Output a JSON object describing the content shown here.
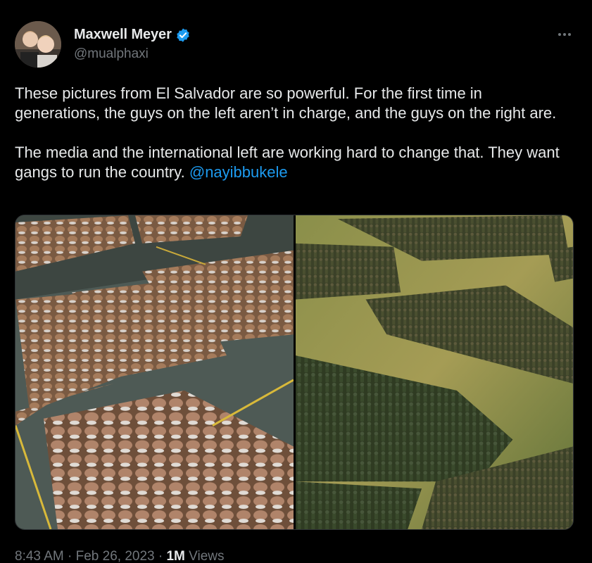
{
  "author": {
    "display_name": "Maxwell Meyer",
    "handle": "@mualphaxi",
    "verified": true,
    "avatar_icon": "profile-photo-two-children"
  },
  "more_icon": "ellipsis-icon",
  "tweet": {
    "paragraph_1": "These pictures from El Salvador are so powerful. For the first time in generations, the guys on the left aren’t in charge, and the guys on the right are.",
    "paragraph_2": "The media and the international left are working hard to change that. They want gangs to run the country. ",
    "mention": "@nayibbukele"
  },
  "media": {
    "left_image": "prison-inmates-seated-in-rows",
    "right_image": "soldiers-in-formation-on-field"
  },
  "meta": {
    "time": "8:43 AM",
    "sep1": " · ",
    "date": "Feb 26, 2023",
    "sep2": " · ",
    "views_count": "1M",
    "views_label": " Views"
  },
  "colors": {
    "background": "#000000",
    "text": "#e7e9ea",
    "secondary": "#71767b",
    "link": "#1d9bf0",
    "verified": "#1d9bf0"
  }
}
